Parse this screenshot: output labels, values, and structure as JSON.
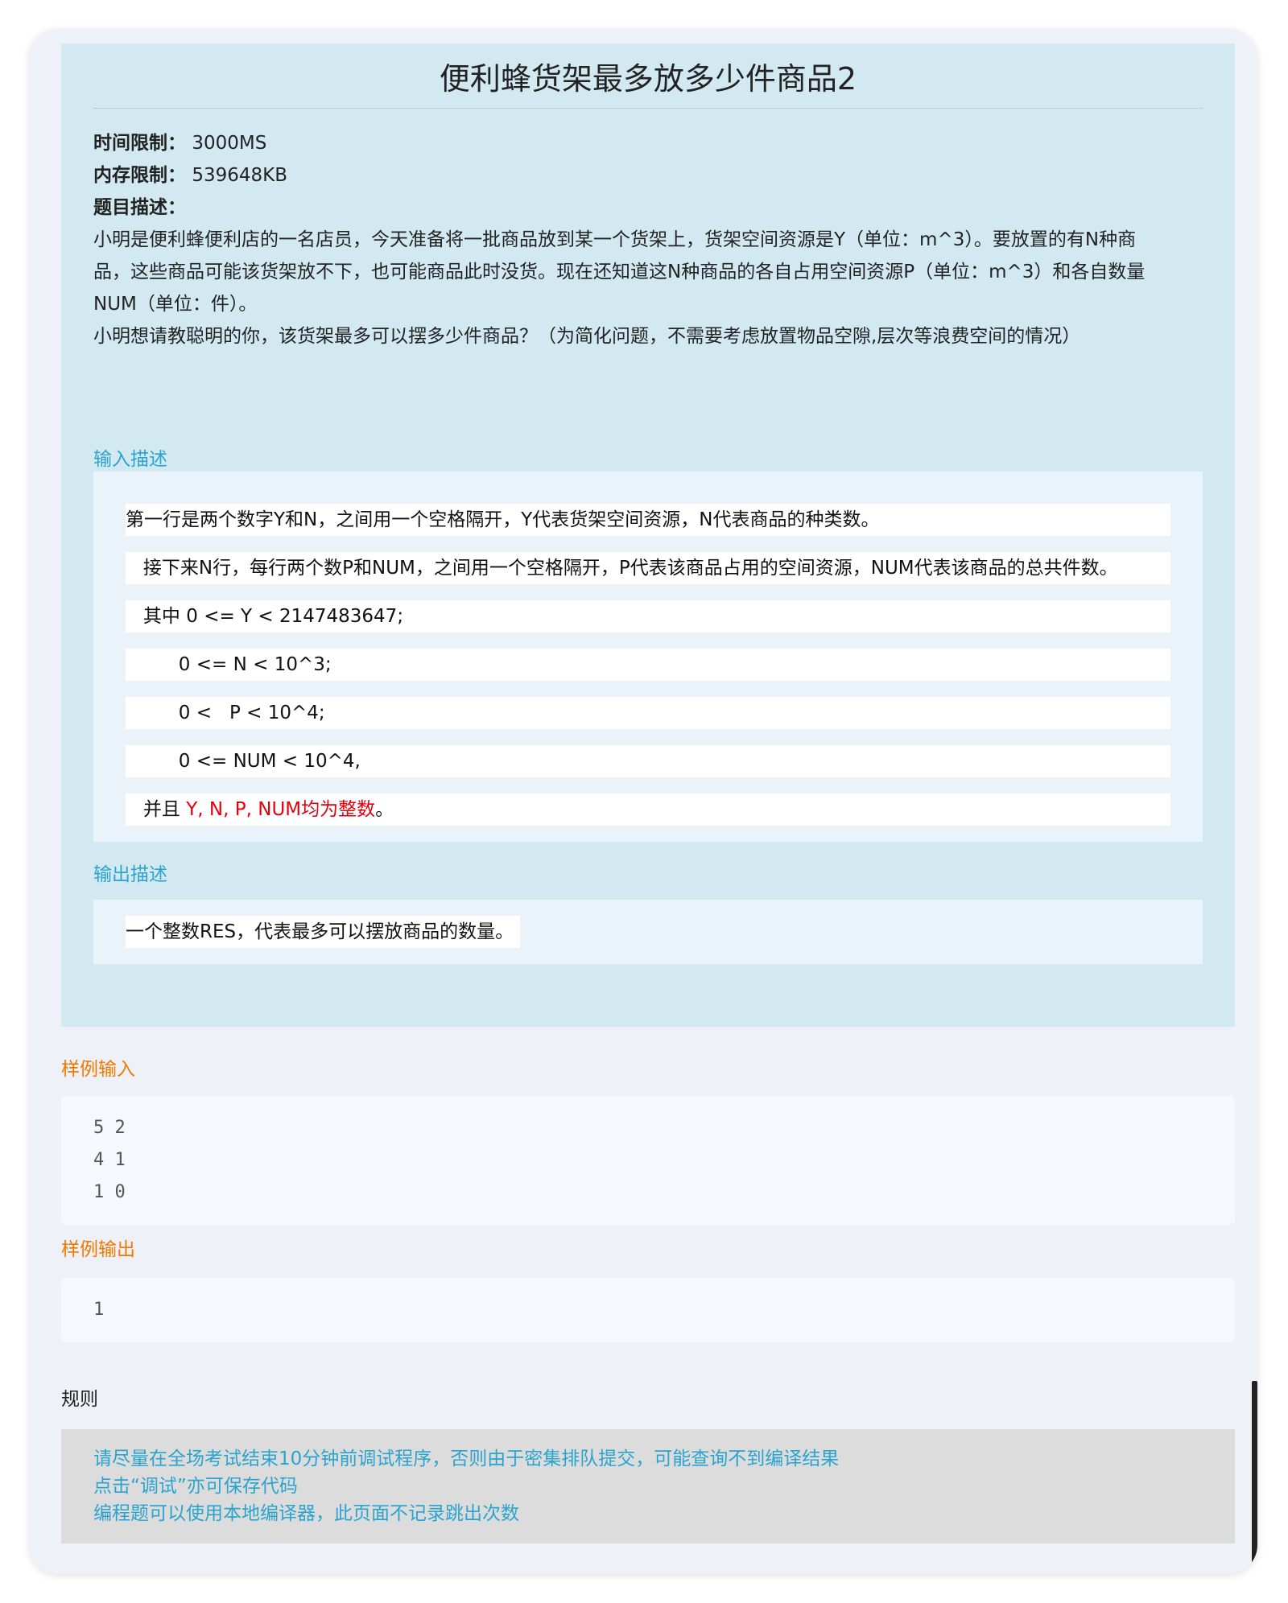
{
  "problem": {
    "title": "便利蜂货架最多放多少件商品2",
    "time_limit_label": "时间限制：",
    "time_limit_value": "3000MS",
    "memory_limit_label": "内存限制：",
    "memory_limit_value": "539648KB",
    "description_label": "题目描述：",
    "description_lines": [
      "小明是便利蜂便利店的一名店员，今天准备将一批商品放到某一个货架上，货架空间资源是Y（单位：m^3）。要放置的有N种商",
      "品，这些商品可能该货架放不下，也可能商品此时没货。现在还知道这N种商品的各自占用空间资源P（单位：m^3）和各自数量",
      "NUM（单位：件）。",
      "小明想请教聪明的你，该货架最多可以摆多少件商品？（为简化问题，不需要考虑放置物品空隙,层次等浪费空间的情况）"
    ]
  },
  "input": {
    "label": "输入描述",
    "lines": [
      "第一行是两个数字Y和N，之间用一个空格隔开，Y代表货架空间资源，N代表商品的种类数。",
      "   接下来N行，每行两个数P和NUM，之间用一个空格隔开，P代表该商品占用的空间资源，NUM代表该商品的总共件数。",
      "   其中 0 <= Y < 2147483647;",
      "         0 <= N < 10^3;",
      "         0 <   P < 10^4;",
      "         0 <= NUM < 10^4,"
    ],
    "last_line_prefix": "   并且 ",
    "last_line_highlight": "Y, N, P, NUM均为整数",
    "last_line_suffix": "。"
  },
  "output": {
    "label": "输出描述",
    "text": "一个整数RES，代表最多可以摆放商品的数量。"
  },
  "sample_input": {
    "label": "样例输入",
    "lines": [
      "5 2",
      "4 1",
      "1 0"
    ]
  },
  "sample_output": {
    "label": "样例输出",
    "lines": [
      "1"
    ]
  },
  "rules": {
    "label": "规则",
    "lines": [
      "请尽量在全场考试结束10分钟前调试程序，否则由于密集排队提交，可能查询不到编译结果",
      "点击“调试”亦可保存代码",
      "编程题可以使用本地编译器，此页面不记录跳出次数"
    ]
  },
  "colors": {
    "problem_bg": "#d3e9f2",
    "section_blue": "#2aa4cf",
    "sample_orange": "#f07a00",
    "highlight_red": "#e3000f"
  }
}
